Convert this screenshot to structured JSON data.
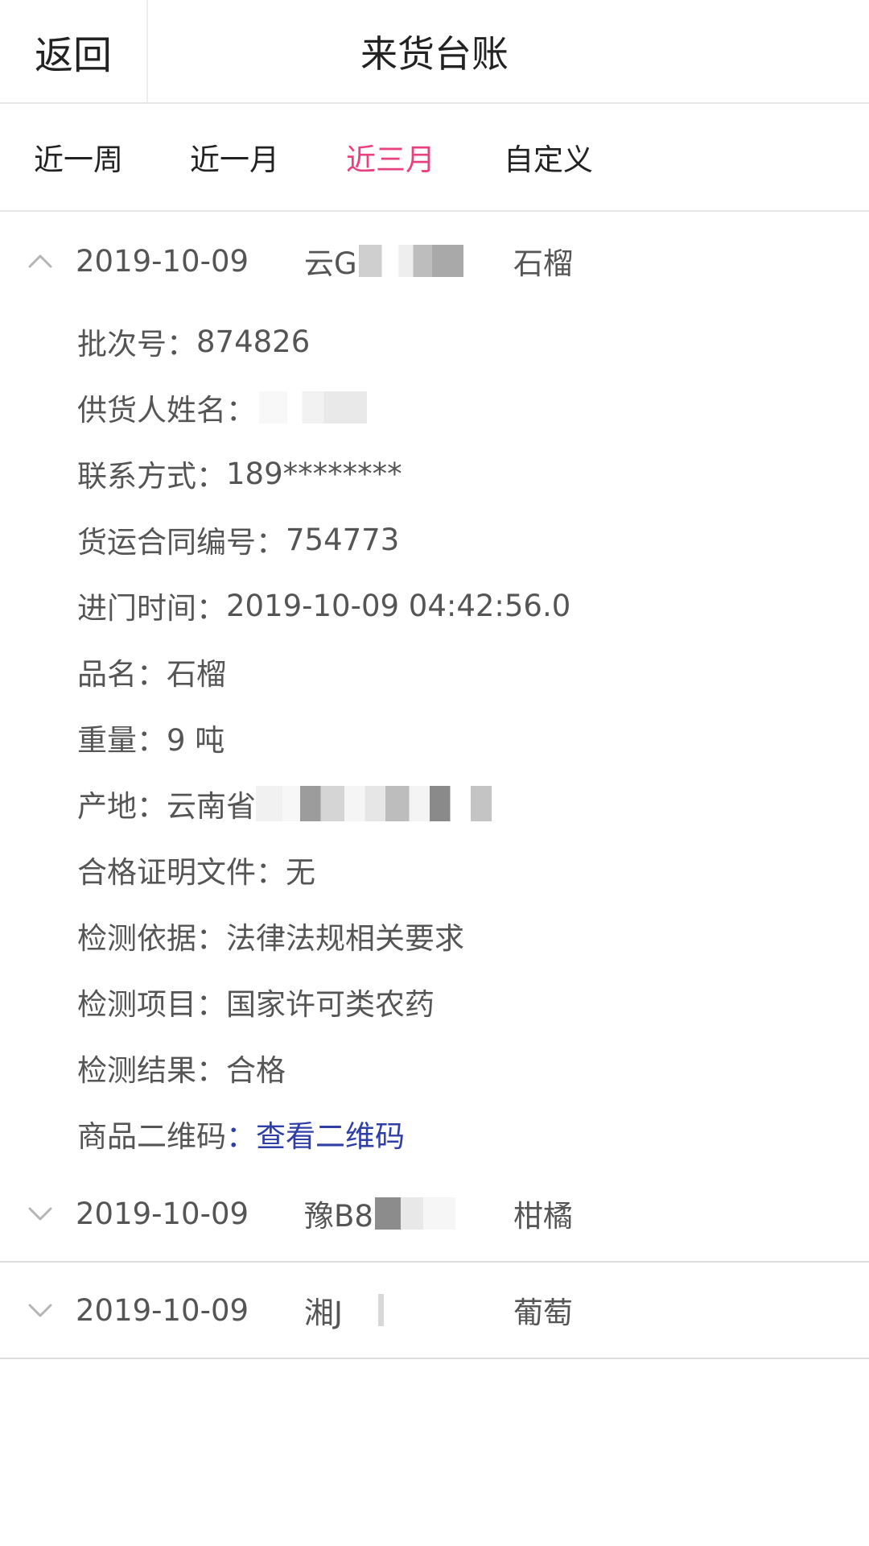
{
  "header": {
    "back_label": "返回",
    "title": "来货台账"
  },
  "filters": {
    "tabs": [
      {
        "label": "近一周"
      },
      {
        "label": "近一月"
      },
      {
        "label": "近三月"
      },
      {
        "label": "自定义"
      }
    ],
    "active_index": 2,
    "active_color": "#e8417f"
  },
  "records": [
    {
      "expanded": true,
      "date": "2019-10-09",
      "plate_prefix": "云G",
      "product": "石榴",
      "details": {
        "batch_label": "批次号：",
        "batch_value": "874826",
        "supplier_label": "供货人姓名：",
        "contact_label": "联系方式：",
        "contact_value": "189********",
        "contract_label": "货运合同编号：",
        "contract_value": "754773",
        "entry_time_label": "进门时间：",
        "entry_time_value": "2019-10-09 04:42:56.0",
        "product_name_label": "品名：",
        "product_name_value": "石榴",
        "weight_label": "重量：",
        "weight_value": "9 吨",
        "origin_label": "产地：",
        "origin_value": "云南省",
        "certificate_label": "合格证明文件：",
        "certificate_value": "无",
        "basis_label": "检测依据：",
        "basis_value": "法律法规相关要求",
        "items_label": "检测项目：",
        "items_value": "国家许可类农药",
        "result_label": "检测结果：",
        "result_value": "合格",
        "qrcode_label": "商品二维码",
        "qrcode_link": "：查看二维码"
      }
    },
    {
      "expanded": false,
      "date": "2019-10-09",
      "plate_prefix": "豫B8",
      "product": "柑橘"
    },
    {
      "expanded": false,
      "date": "2019-10-09",
      "plate_prefix": "湘J",
      "product": "葡萄"
    }
  ],
  "colors": {
    "link": "#2f3fa6",
    "text": "#555555",
    "divider": "#dcdcdc"
  },
  "icons": {
    "expanded": "chevron-up-icon",
    "collapsed": "chevron-down-icon"
  }
}
